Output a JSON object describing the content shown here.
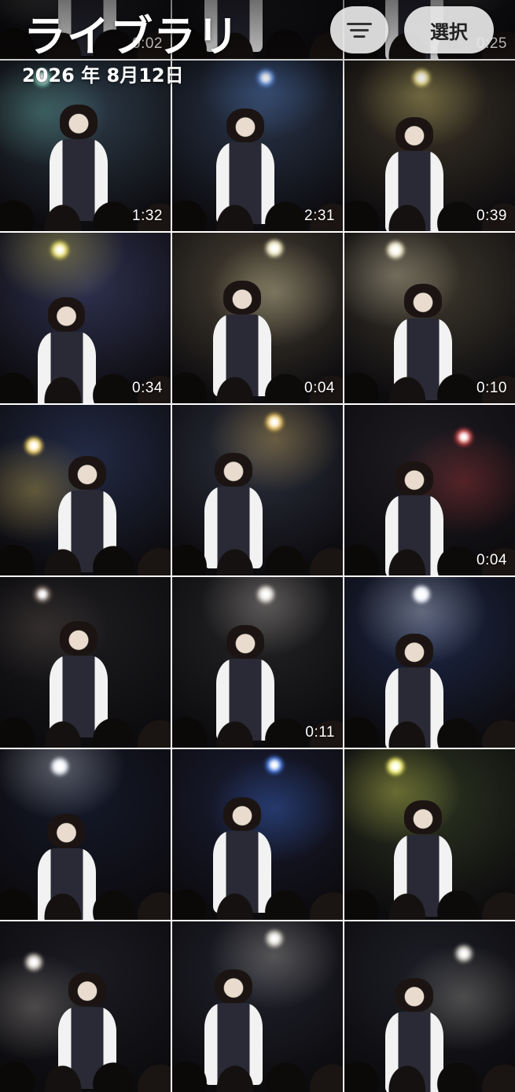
{
  "header": {
    "title": "ライブラリ",
    "date": "2026 年 8月12日",
    "select_label": "選択",
    "sort_icon": "sort-lines-icon"
  },
  "grid": {
    "items": [
      {
        "duration": "0:02",
        "bg": "#3b3a44",
        "light": "#d6d3c8"
      },
      {
        "duration": "",
        "bg": "#2d2a30",
        "light": "#c9c4b6"
      },
      {
        "duration": "0:25",
        "bg": "#34323a",
        "light": "#cfc8bb"
      },
      {
        "duration": "1:32",
        "bg": "#2c3a48",
        "light": "#6fc2b0"
      },
      {
        "duration": "2:31",
        "bg": "#283347",
        "light": "#5d8fe0"
      },
      {
        "duration": "0:39",
        "bg": "#3a3326",
        "light": "#e6d77a"
      },
      {
        "duration": "0:34",
        "bg": "#2f3150",
        "light": "#e8de5a"
      },
      {
        "duration": "0:04",
        "bg": "#4a4335",
        "light": "#efe6b8"
      },
      {
        "duration": "0:10",
        "bg": "#3f3a2e",
        "light": "#f0e9c8"
      },
      {
        "duration": "",
        "bg": "#222a45",
        "light": "#f7d35a"
      },
      {
        "duration": "",
        "bg": "#2b2f3d",
        "light": "#f0c35a"
      },
      {
        "duration": "0:04",
        "bg": "#1f1c22",
        "light": "#c93c3c"
      },
      {
        "duration": "",
        "bg": "#1c1b1e",
        "light": "#6b5e55"
      },
      {
        "duration": "0:11",
        "bg": "#232224",
        "light": "#d8d3cc"
      },
      {
        "duration": "",
        "bg": "#1d2746",
        "light": "#f3f6ff"
      },
      {
        "duration": "",
        "bg": "#141828",
        "light": "#e8ecf5"
      },
      {
        "duration": "",
        "bg": "#1a1d34",
        "light": "#3e78e8"
      },
      {
        "duration": "",
        "bg": "#2c3420",
        "light": "#f2f060"
      },
      {
        "duration": "",
        "bg": "#1b1b22",
        "light": "#bdb7ad"
      },
      {
        "duration": "",
        "bg": "#20222c",
        "light": "#c7c2b8"
      },
      {
        "duration": "",
        "bg": "#1d1f26",
        "light": "#b9b4ab"
      }
    ]
  }
}
